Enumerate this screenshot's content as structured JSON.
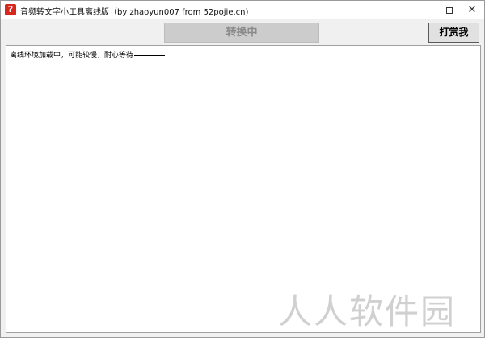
{
  "window": {
    "title": "音频转文字小工具离线版（by zhaoyun007 from 52pojie.cn)",
    "app_icon_glyph": "?",
    "controls": {
      "minimize": "minimize-icon",
      "maximize": "maximize-icon",
      "close": "close-icon",
      "close_glyph": "✕"
    }
  },
  "toolbar": {
    "convert_label": "转换中",
    "donate_label": "打赏我"
  },
  "output": {
    "text": "离线环境加载中，可能较慢，耐心等待"
  },
  "watermark": {
    "text": "人人软件园"
  },
  "colors": {
    "app_icon": "#d7261b",
    "convert_disabled_bg": "#cccccc",
    "convert_disabled_text": "#8a8a8a",
    "window_bg": "#f0f0f0"
  }
}
